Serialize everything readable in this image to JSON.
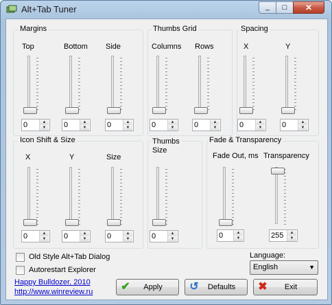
{
  "window": {
    "title": "Alt+Tab Tuner",
    "close_glyph": "✕",
    "min_glyph": "_",
    "max_glyph": "□"
  },
  "groups": {
    "margins": {
      "title": "Margins",
      "cols": [
        "Top",
        "Bottom",
        "Side"
      ],
      "values": [
        "0",
        "0",
        "0"
      ]
    },
    "thumbs_grid": {
      "title": "Thumbs Grid",
      "cols": [
        "Columns",
        "Rows"
      ],
      "values": [
        "0",
        "0"
      ]
    },
    "spacing": {
      "title": "Spacing",
      "cols": [
        "X",
        "Y"
      ],
      "values": [
        "0",
        "0"
      ]
    },
    "icon_shift": {
      "title": "Icon Shift & Size",
      "cols": [
        "X",
        "Y",
        "Size"
      ],
      "values": [
        "0",
        "0",
        "0"
      ]
    },
    "thumbs_size": {
      "title": "Thumbs\nSize",
      "values": [
        "0"
      ]
    },
    "fade": {
      "title": "Fade & Transparency",
      "cols": [
        "Fade Out, ms",
        "Transparency"
      ],
      "values": [
        "0",
        "255"
      ]
    }
  },
  "options": {
    "old_style": "Old Style Alt+Tab Dialog",
    "autorestart": "Autorestart Explorer"
  },
  "links": {
    "author": "Happy Bulldozer, 2010",
    "site": "http://www.winreview.ru"
  },
  "language": {
    "label": "Language:",
    "value": "English"
  },
  "buttons": {
    "apply": "Apply",
    "defaults": "Defaults",
    "exit": "Exit"
  },
  "colors": {
    "link": "#0000cc",
    "close": "#c85b46"
  }
}
